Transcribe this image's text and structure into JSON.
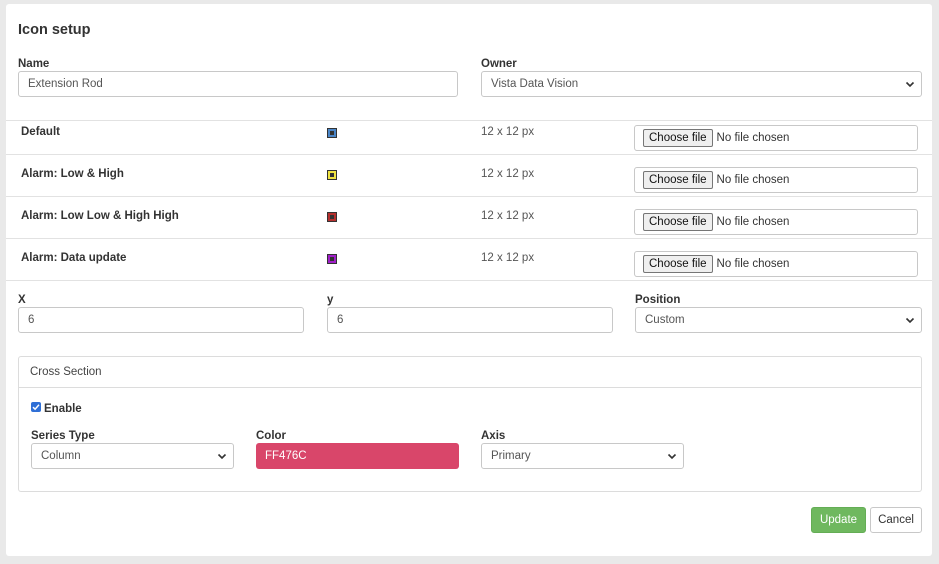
{
  "dialog": {
    "title": "Icon setup"
  },
  "name_field": {
    "label": "Name",
    "value": "Extension Rod"
  },
  "owner_field": {
    "label": "Owner",
    "value": "Vista Data Vision"
  },
  "icons": [
    {
      "name": "Default",
      "color": "#4a86c8",
      "size": "12 x 12 px",
      "file_button": "Choose file",
      "file_status": "No file chosen"
    },
    {
      "name": "Alarm: Low & High",
      "color": "#f0e442",
      "size": "12 x 12 px",
      "file_button": "Choose file",
      "file_status": "No file chosen"
    },
    {
      "name": "Alarm: Low Low & High High",
      "color": "#b5302e",
      "size": "12 x 12 px",
      "file_button": "Choose file",
      "file_status": "No file chosen"
    },
    {
      "name": "Alarm: Data update",
      "color": "#a020c8",
      "size": "12 x 12 px",
      "file_button": "Choose file",
      "file_status": "No file chosen"
    }
  ],
  "x_field": {
    "label": "X",
    "value": "6"
  },
  "y_field": {
    "label": "y",
    "value": "6"
  },
  "position_field": {
    "label": "Position",
    "value": "Custom"
  },
  "cross_section": {
    "header": "Cross Section",
    "enable_label": "Enable",
    "enabled": true,
    "series_type": {
      "label": "Series Type",
      "value": "Column"
    },
    "color": {
      "label": "Color",
      "value": "FF476C",
      "hex": "#d9466a"
    },
    "axis": {
      "label": "Axis",
      "value": "Primary"
    }
  },
  "actions": {
    "update_label": "Update",
    "cancel_label": "Cancel"
  }
}
